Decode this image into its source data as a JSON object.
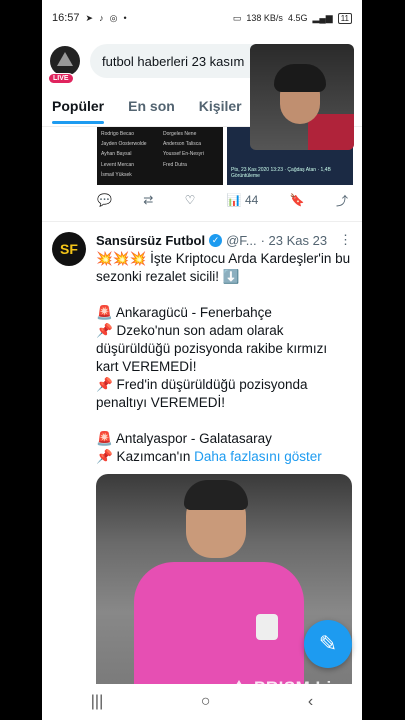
{
  "status_bar": {
    "time": "16:57",
    "network": "4.5G",
    "speed": "138 KB/s",
    "battery": "11"
  },
  "search": {
    "value": "futbol haberleri 23 kasım",
    "live_label": "LIVE"
  },
  "tabs": [
    {
      "label": "Popüler",
      "active": true
    },
    {
      "label": "En son",
      "active": false
    },
    {
      "label": "Kişiler",
      "active": false
    }
  ],
  "prev_tweet": {
    "views": "44",
    "thumb_names": [
      "Rodrigo Becao",
      "Dorgeles Nene",
      "Jayden Oosterwolde",
      "Anderson Talisca",
      "Ayhan Baysal",
      "Youssef En-Nesyri",
      "Levent Mercan",
      "Fred Dutra",
      "İsmail Yüksek",
      ""
    ],
    "thumb2_text": "Pts, 23 Kas 2020 13:23 · Çağdaş Atan · 1,4B Görüntüleme"
  },
  "tweet": {
    "name": "Sansürsüz Futbol",
    "handle": "@F...",
    "date": "· 23 Kas 23",
    "logo_text": "SF",
    "lines": [
      "💥💥💥 İşte Kriptocu Arda Kardeşler'in bu sezonki rezalet sicili! ⬇️",
      "",
      "🚨 Ankaragücü - Fenerbahçe",
      "📌 Dzeko'nun son adam olarak düşürüldüğü pozisyonda rakibe kırmızı kart VEREMEDİ!",
      "📌 Fred'in düşürüldüğü pozisyonda penaltıyı VEREMEDİ!",
      "",
      "🚨 Antalyaspor - Galatasaray"
    ],
    "last_line_prefix": "📌 Kazımcan'ın ",
    "show_more": "Daha fazlasını göster"
  },
  "fab_icon": "compose-icon",
  "watermark": "PRISM Live",
  "colors": {
    "accent": "#1d9bf0",
    "live": "#e0245e"
  }
}
